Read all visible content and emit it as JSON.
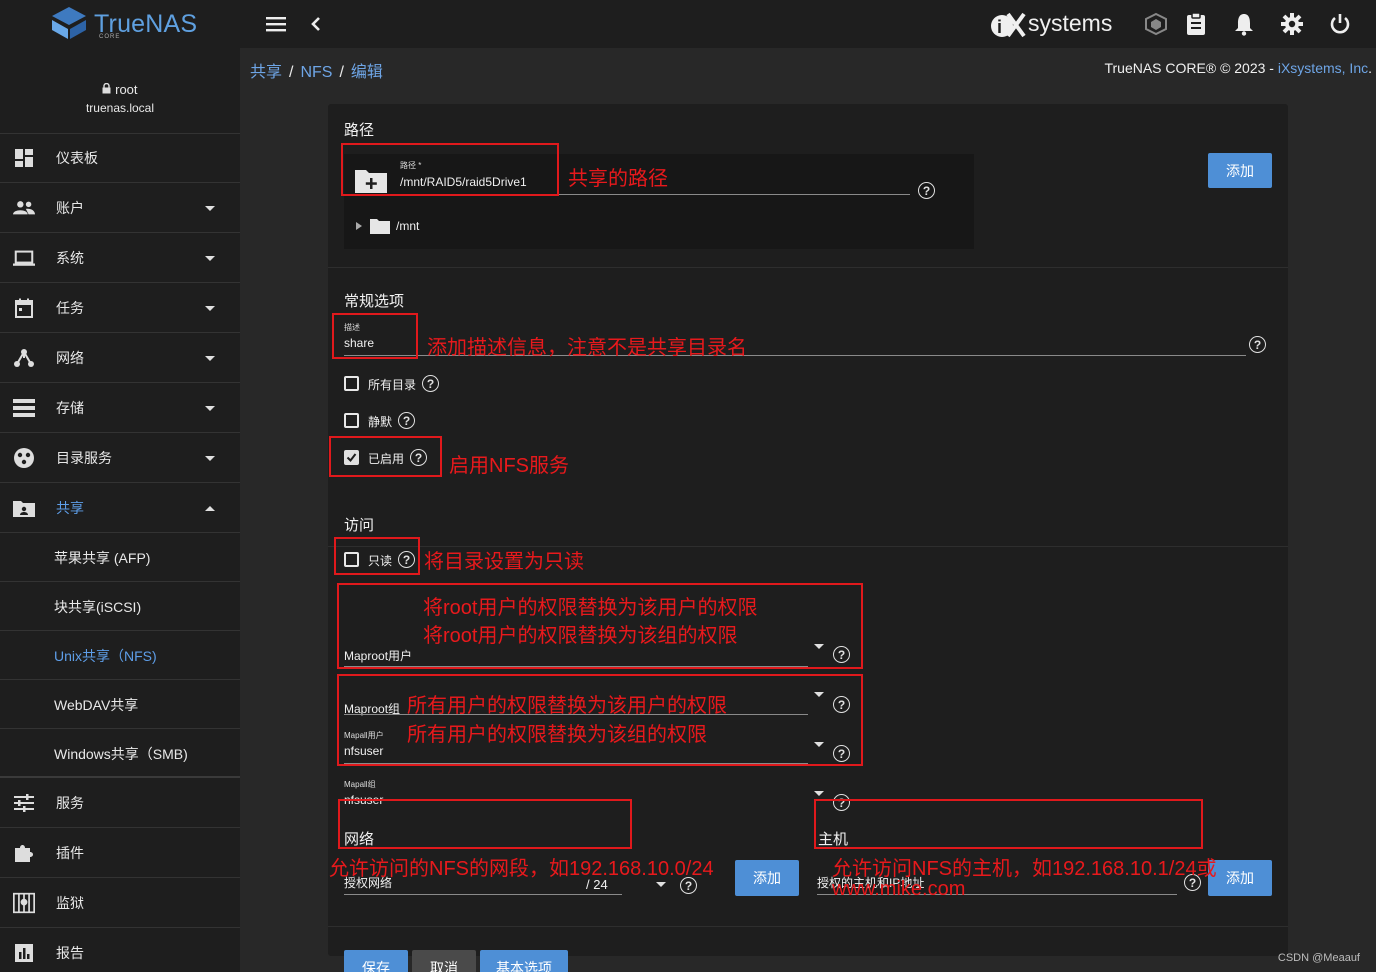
{
  "app": {
    "logo_text": "TrueNAS",
    "logo_sub": "CORE",
    "vendor_logo": "systems"
  },
  "user": {
    "name": "root",
    "host": "truenas.local"
  },
  "sidebar": {
    "items": [
      {
        "label": "仪表板",
        "icon": "dashboard-icon"
      },
      {
        "label": "账户",
        "icon": "people-icon"
      },
      {
        "label": "系统",
        "icon": "laptop-icon"
      },
      {
        "label": "任务",
        "icon": "calendar-icon"
      },
      {
        "label": "网络",
        "icon": "network-icon"
      },
      {
        "label": "存储",
        "icon": "storage-icon"
      },
      {
        "label": "目录服务",
        "icon": "directory-icon"
      },
      {
        "label": "共享",
        "icon": "share-folder-icon"
      }
    ],
    "sub_items": [
      {
        "label": "苹果共享 (AFP)"
      },
      {
        "label": "块共享(iSCSI)"
      },
      {
        "label": "Unix共享（NFS)"
      },
      {
        "label": "WebDAV共享"
      },
      {
        "label": "Windows共享（SMB)"
      }
    ],
    "bottom_items": [
      {
        "label": "服务",
        "icon": "tune-icon"
      },
      {
        "label": "插件",
        "icon": "puzzle-icon"
      },
      {
        "label": "监狱",
        "icon": "jail-icon"
      },
      {
        "label": "报告",
        "icon": "report-icon"
      }
    ]
  },
  "breadcrumb": {
    "a": "共享",
    "b": "NFS",
    "c": "编辑"
  },
  "copyright": {
    "text": "TrueNAS CORE® © 2023 - ",
    "link": "iXsystems, Inc",
    "suffix": "."
  },
  "form": {
    "path_section": "路径",
    "path_label": "路径 *",
    "path_value": "/mnt/RAID5/raid5Drive1",
    "tree_root": "/mnt",
    "add_button": "添加",
    "general_section": "常规选项",
    "desc_label": "描述",
    "desc_value": "share",
    "all_dirs": "所有目录",
    "quiet": "静默",
    "enabled": "已启用",
    "access_section": "访问",
    "readonly": "只读",
    "maproot_user": "Maproot用户",
    "maproot_group": "Maproot组",
    "mapall_user_label": "Mapall用户",
    "mapall_user_value": "nfsuser",
    "mapall_group_label": "Mapall组",
    "mapall_group_value": "nfsuser",
    "network_section": "网络",
    "network_label": "授权网络",
    "network_mask": "/ 24",
    "host_section": "主机",
    "host_label": "授权的主机和IP地址",
    "save": "保存",
    "cancel": "取消",
    "basic": "基本选项"
  },
  "annotations": {
    "path": "共享的路径",
    "desc": "添加描述信息，注意不是共享目录名",
    "enabled": "启用NFS服务",
    "readonly": "将目录设置为只读",
    "maproot_user": "将root用户的权限替换为该用户的权限",
    "maproot_group": "将root用户的权限替换为该组的权限",
    "mapall_user": "所有用户的权限替换为该用户的权限",
    "mapall_group": "所有用户的权限替换为该组的权限",
    "network": "允许访问的NFS的网段，如192.168.10.0/24",
    "host_line1": "允许访问NFS的主机，如192.168.10.1/24或",
    "host_line2": "www.mike.com"
  },
  "watermark": "CSDN @Meaauf",
  "colors": {
    "accent": "#4e8fd6",
    "annotation": "#e0191c",
    "link": "#6ea5e6"
  }
}
